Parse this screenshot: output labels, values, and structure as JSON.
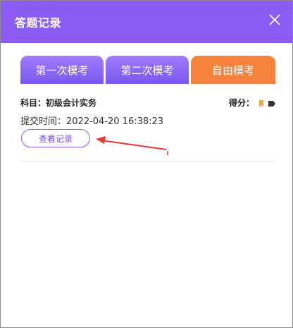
{
  "dialog": {
    "title": "答题记录",
    "close_icon": "close-icon"
  },
  "tabs": [
    {
      "label": "第一次模考",
      "color": "#8b5cf6"
    },
    {
      "label": "第二次模考",
      "color": "#8b5cf6"
    },
    {
      "label": "自由模考",
      "color": "#f7823c",
      "selected": true
    }
  ],
  "record": {
    "subject_text": "科目：初级会计实务",
    "score_label": "得分：",
    "submit_text": "提交时间：2022-04-20 16:38:23",
    "view_button": "查看记录"
  },
  "colors": {
    "header": "#8b5cf6",
    "accent_orange": "#f7823c",
    "annotation_arrow": "#e53935"
  }
}
